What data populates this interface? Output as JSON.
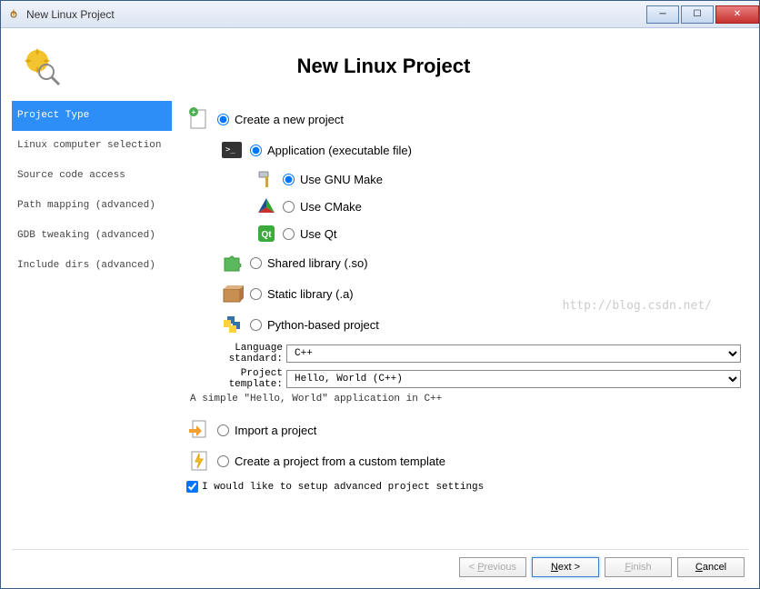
{
  "titlebar": {
    "text": "New Linux Project"
  },
  "header": {
    "title": "New Linux Project"
  },
  "sidebar": {
    "items": [
      {
        "label": "Project Type",
        "selected": true
      },
      {
        "label": "Linux computer selection",
        "selected": false
      },
      {
        "label": "Source code access",
        "selected": false
      },
      {
        "label": "Path mapping (advanced)",
        "selected": false
      },
      {
        "label": "GDB tweaking (advanced)",
        "selected": false
      },
      {
        "label": "Include dirs (advanced)",
        "selected": false
      }
    ]
  },
  "options": {
    "create_new": "Create a new project",
    "application": "Application (executable file)",
    "gnu_make": "Use GNU Make",
    "cmake": "Use CMake",
    "qt": "Use Qt",
    "shared_lib": "Shared library (.so)",
    "static_lib": "Static library (.a)",
    "python": "Python-based project",
    "import": "Import a project",
    "custom_template": "Create a project from a custom template"
  },
  "form": {
    "language_label": "Language standard:",
    "language_value": "C++",
    "template_label": "Project template:",
    "template_value": "Hello, World (C++)",
    "template_desc": "A simple \"Hello, World\" application in C++"
  },
  "checkbox": {
    "advanced_label": "I would like to setup advanced project settings",
    "checked": true
  },
  "footer": {
    "previous": "Previous",
    "next": "Next",
    "finish": "Finish",
    "cancel": "Cancel"
  },
  "watermark": "http://blog.csdn.net/"
}
